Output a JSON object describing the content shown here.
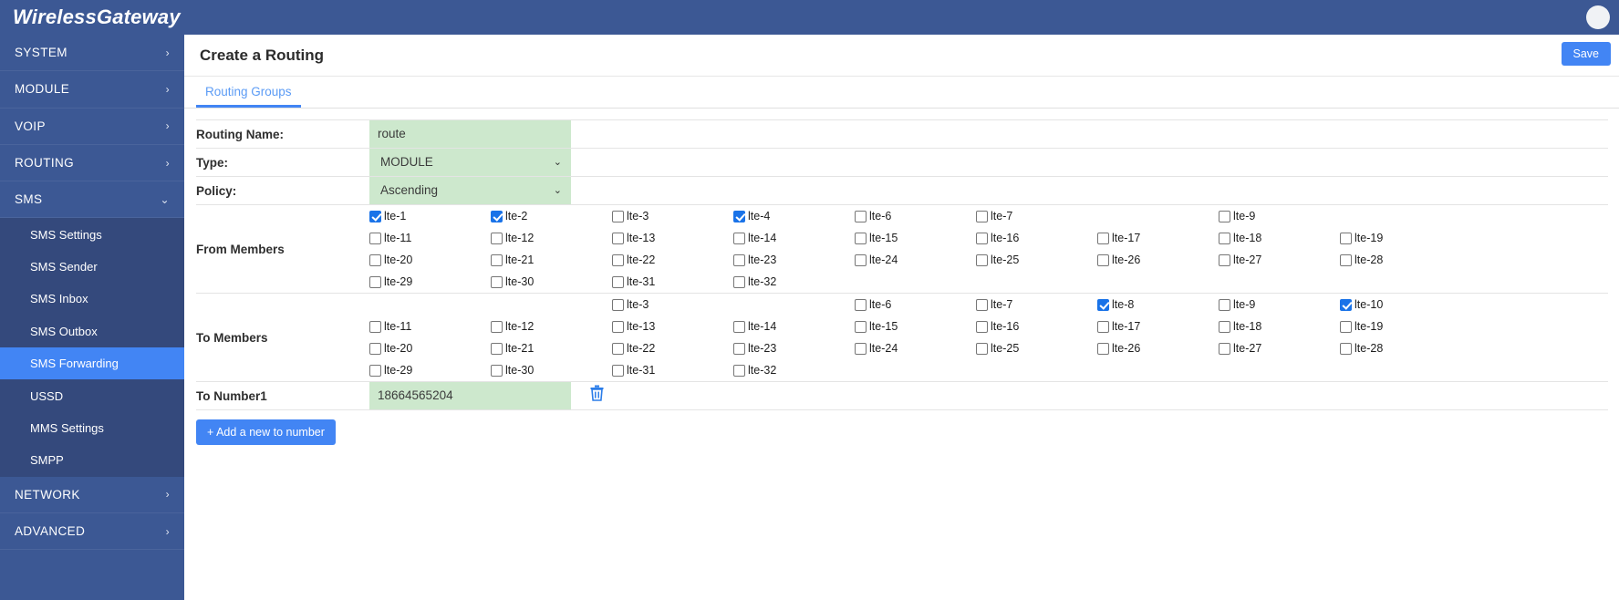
{
  "header": {
    "brand": "WirelessGateway",
    "user_icon": "user-avatar-icon"
  },
  "sidebar": {
    "items": [
      {
        "label": "SYSTEM",
        "caret": "›",
        "expanded": false
      },
      {
        "label": "MODULE",
        "caret": "›",
        "expanded": false
      },
      {
        "label": "VOIP",
        "caret": "›",
        "expanded": false
      },
      {
        "label": "ROUTING",
        "caret": "›",
        "expanded": false
      },
      {
        "label": "SMS",
        "caret": "⌄",
        "expanded": true
      },
      {
        "label": "NETWORK",
        "caret": "›",
        "expanded": false
      },
      {
        "label": "ADVANCED",
        "caret": "›",
        "expanded": false
      }
    ],
    "sms_submenu": [
      {
        "label": "SMS Settings",
        "active": false
      },
      {
        "label": "SMS Sender",
        "active": false
      },
      {
        "label": "SMS Inbox",
        "active": false
      },
      {
        "label": "SMS Outbox",
        "active": false
      },
      {
        "label": "SMS Forwarding",
        "active": true
      },
      {
        "label": "USSD",
        "active": false
      },
      {
        "label": "MMS Settings",
        "active": false
      },
      {
        "label": "SMPP",
        "active": false
      }
    ]
  },
  "page": {
    "title": "Create a Routing",
    "save_label": "Save",
    "tab_label": "Routing Groups"
  },
  "form": {
    "routing_name_label": "Routing Name:",
    "routing_name_value": "route",
    "type_label": "Type:",
    "type_value": "MODULE",
    "type_options": [
      "MODULE"
    ],
    "policy_label": "Policy:",
    "policy_value": "Ascending",
    "policy_options": [
      "Ascending"
    ],
    "from_members_label": "From Members",
    "to_members_label": "To Members",
    "to_number_label": "To Number1",
    "to_number_value": "18664565204",
    "delete_icon": "trash-icon",
    "add_number_label": "+ Add a new to number",
    "select_arrow": "⌄"
  },
  "from_members": [
    {
      "label": "lte-1",
      "checked": true,
      "present": true
    },
    {
      "label": "lte-2",
      "checked": true,
      "present": true
    },
    {
      "label": "lte-3",
      "checked": false,
      "present": true
    },
    {
      "label": "lte-4",
      "checked": true,
      "present": true
    },
    {
      "label": "lte-6",
      "checked": false,
      "present": true
    },
    {
      "label": "lte-7",
      "checked": false,
      "present": true
    },
    {
      "label": "",
      "checked": false,
      "present": false
    },
    {
      "label": "lte-9",
      "checked": false,
      "present": true
    },
    {
      "label": "",
      "checked": false,
      "present": false
    },
    {
      "label": "lte-11",
      "checked": false,
      "present": true
    },
    {
      "label": "lte-12",
      "checked": false,
      "present": true
    },
    {
      "label": "lte-13",
      "checked": false,
      "present": true
    },
    {
      "label": "lte-14",
      "checked": false,
      "present": true
    },
    {
      "label": "lte-15",
      "checked": false,
      "present": true
    },
    {
      "label": "lte-16",
      "checked": false,
      "present": true
    },
    {
      "label": "lte-17",
      "checked": false,
      "present": true
    },
    {
      "label": "lte-18",
      "checked": false,
      "present": true
    },
    {
      "label": "lte-19",
      "checked": false,
      "present": true
    },
    {
      "label": "lte-20",
      "checked": false,
      "present": true
    },
    {
      "label": "lte-21",
      "checked": false,
      "present": true
    },
    {
      "label": "lte-22",
      "checked": false,
      "present": true
    },
    {
      "label": "lte-23",
      "checked": false,
      "present": true
    },
    {
      "label": "lte-24",
      "checked": false,
      "present": true
    },
    {
      "label": "lte-25",
      "checked": false,
      "present": true
    },
    {
      "label": "lte-26",
      "checked": false,
      "present": true
    },
    {
      "label": "lte-27",
      "checked": false,
      "present": true
    },
    {
      "label": "lte-28",
      "checked": false,
      "present": true
    },
    {
      "label": "lte-29",
      "checked": false,
      "present": true
    },
    {
      "label": "lte-30",
      "checked": false,
      "present": true
    },
    {
      "label": "lte-31",
      "checked": false,
      "present": true
    },
    {
      "label": "lte-32",
      "checked": false,
      "present": true
    },
    {
      "label": "",
      "checked": false,
      "present": false
    },
    {
      "label": "",
      "checked": false,
      "present": false
    },
    {
      "label": "",
      "checked": false,
      "present": false
    },
    {
      "label": "",
      "checked": false,
      "present": false
    },
    {
      "label": "",
      "checked": false,
      "present": false
    }
  ],
  "to_members": [
    {
      "label": "",
      "checked": false,
      "present": false
    },
    {
      "label": "",
      "checked": false,
      "present": false
    },
    {
      "label": "lte-3",
      "checked": false,
      "present": true
    },
    {
      "label": "",
      "checked": false,
      "present": false
    },
    {
      "label": "lte-6",
      "checked": false,
      "present": true
    },
    {
      "label": "lte-7",
      "checked": false,
      "present": true
    },
    {
      "label": "lte-8",
      "checked": true,
      "present": true
    },
    {
      "label": "lte-9",
      "checked": false,
      "present": true
    },
    {
      "label": "lte-10",
      "checked": true,
      "present": true
    },
    {
      "label": "lte-11",
      "checked": false,
      "present": true
    },
    {
      "label": "lte-12",
      "checked": false,
      "present": true
    },
    {
      "label": "lte-13",
      "checked": false,
      "present": true
    },
    {
      "label": "lte-14",
      "checked": false,
      "present": true
    },
    {
      "label": "lte-15",
      "checked": false,
      "present": true
    },
    {
      "label": "lte-16",
      "checked": false,
      "present": true
    },
    {
      "label": "lte-17",
      "checked": false,
      "present": true
    },
    {
      "label": "lte-18",
      "checked": false,
      "present": true
    },
    {
      "label": "lte-19",
      "checked": false,
      "present": true
    },
    {
      "label": "lte-20",
      "checked": false,
      "present": true
    },
    {
      "label": "lte-21",
      "checked": false,
      "present": true
    },
    {
      "label": "lte-22",
      "checked": false,
      "present": true
    },
    {
      "label": "lte-23",
      "checked": false,
      "present": true
    },
    {
      "label": "lte-24",
      "checked": false,
      "present": true
    },
    {
      "label": "lte-25",
      "checked": false,
      "present": true
    },
    {
      "label": "lte-26",
      "checked": false,
      "present": true
    },
    {
      "label": "lte-27",
      "checked": false,
      "present": true
    },
    {
      "label": "lte-28",
      "checked": false,
      "present": true
    },
    {
      "label": "lte-29",
      "checked": false,
      "present": true
    },
    {
      "label": "lte-30",
      "checked": false,
      "present": true
    },
    {
      "label": "lte-31",
      "checked": false,
      "present": true
    },
    {
      "label": "lte-32",
      "checked": false,
      "present": true
    },
    {
      "label": "",
      "checked": false,
      "present": false
    },
    {
      "label": "",
      "checked": false,
      "present": false
    },
    {
      "label": "",
      "checked": false,
      "present": false
    },
    {
      "label": "",
      "checked": false,
      "present": false
    },
    {
      "label": "",
      "checked": false,
      "present": false
    }
  ],
  "colors": {
    "brand_blue": "#3c5894",
    "accent_blue": "#4285f4",
    "field_green": "#cde8cd",
    "submenu_bg": "#34497c"
  }
}
